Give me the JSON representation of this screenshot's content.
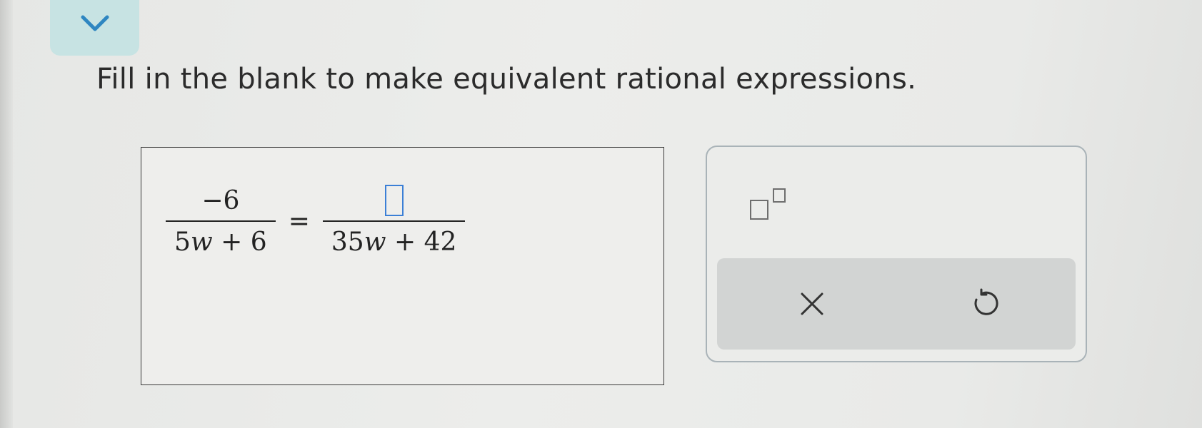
{
  "header": {
    "collapse_icon": "chevron-down-icon",
    "accent_color": "#c7e3e3"
  },
  "prompt": {
    "text": "Fill in the blank to make equivalent rational expressions."
  },
  "equation": {
    "left_numerator": "−6",
    "left_denominator_coef": "5",
    "left_denominator_var": "w",
    "left_denominator_rest": " + 6",
    "equals": "=",
    "right_numerator_value": "",
    "right_denominator_coef": "35",
    "right_denominator_var": "w",
    "right_denominator_rest": " + 42"
  },
  "toolbox": {
    "exponent_icon": "exponent-template-icon",
    "clear_icon": "close-icon",
    "undo_icon": "undo-icon",
    "blank_border_color": "#3b7fd6"
  }
}
